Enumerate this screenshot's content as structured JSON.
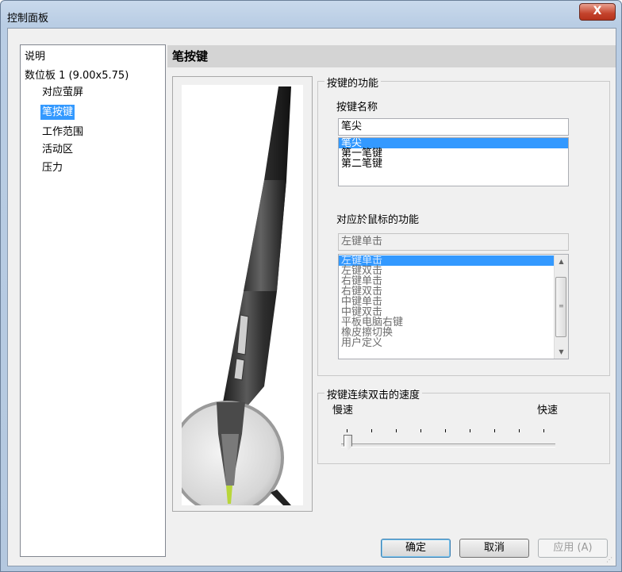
{
  "window": {
    "title": "控制面板",
    "close_glyph": "X"
  },
  "sidebar": {
    "items": [
      {
        "label": "说明",
        "level": 0,
        "selected": false
      },
      {
        "label": "数位板 1 (9.00x5.75)",
        "level": 0,
        "selected": false
      },
      {
        "label": "对应萤屏",
        "level": 1,
        "selected": false
      },
      {
        "label": "笔按键",
        "level": 1,
        "selected": true
      },
      {
        "label": "工作范围",
        "level": 1,
        "selected": false
      },
      {
        "label": "活动区",
        "level": 1,
        "selected": false
      },
      {
        "label": "压力",
        "level": 1,
        "selected": false
      }
    ]
  },
  "header": {
    "title": "笔按键"
  },
  "button_function": {
    "group_title": "按键的功能",
    "name_label": "按键名称",
    "current_value": "笔尖",
    "options": [
      "笔尖",
      "第一笔键",
      "第二笔键"
    ],
    "selected_index": 0
  },
  "mouse_function": {
    "label": "对应於鼠标的功能",
    "current_value": "左键单击",
    "options": [
      "左键单击",
      "左键双击",
      "右键单击",
      "右键双击",
      "中键单击",
      "中键双击",
      "平板电脑右键",
      "橡皮擦切换",
      "用户定义"
    ],
    "selected_index": 0
  },
  "double_click_speed": {
    "group_title": "按键连续双击的速度",
    "slow_label": "慢速",
    "fast_label": "快速",
    "value_fraction": 0.0
  },
  "footer": {
    "ok_label": "确定",
    "cancel_label": "取消",
    "apply_label": "应用 (A)"
  },
  "colors": {
    "selection": "#3399ff",
    "pen_tip": "#b8d63a",
    "close_button": "#c4432c"
  }
}
